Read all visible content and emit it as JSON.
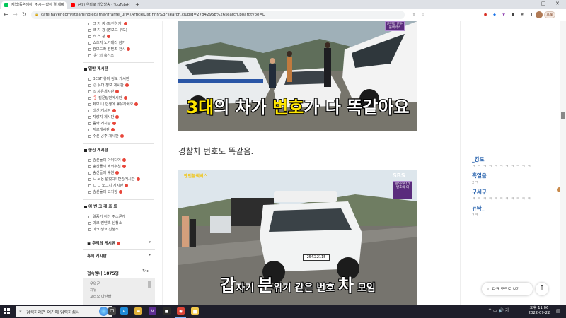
{
  "browser": {
    "tabs": [
      {
        "title": "재업(동역에이) 주시는 잡어 걸 게이",
        "active": true,
        "favicon_color": "#03c75a"
      },
      {
        "title": "(49) 우파로 개입방송 - YouTube",
        "active": false,
        "favicon_color": "#ff0000"
      }
    ],
    "new_tab": "+",
    "window_buttons": [
      "—",
      "□",
      "✕"
    ],
    "nav": {
      "back": "←",
      "forward": "→",
      "reload": "↻"
    },
    "url": "cafe.naver.com/steamindiegame?iframe_url=/ArticleList.nhn%3Fsearch.clubid=27842958%26search.boardtype=L",
    "extensions": [
      {
        "icon": "share-icon",
        "glyph": "⇪",
        "color": "#666"
      },
      {
        "icon": "star-icon",
        "glyph": "☆",
        "color": "#666"
      },
      {
        "icon": "ext-red-icon",
        "glyph": "●",
        "color": "#d93025"
      },
      {
        "icon": "ext-blue-icon",
        "glyph": "◆",
        "color": "#1a73e8"
      },
      {
        "icon": "ext-purple-icon",
        "glyph": "V",
        "color": "#7b1fa2"
      },
      {
        "icon": "ext-dark-icon",
        "glyph": "■",
        "color": "#444"
      },
      {
        "icon": "ext-puzzle-icon",
        "glyph": "✱",
        "color": "#666"
      },
      {
        "icon": "sidebar-icon",
        "glyph": "▮",
        "color": "#666"
      }
    ],
    "profile_label": "프로"
  },
  "sidebar": {
    "top_items": [
      {
        "label": "크 지 광 (트전하기)",
        "new": true
      },
      {
        "label": "크 지 광 (방보드 투보)",
        "new": false
      },
      {
        "label": "쇼 스 광",
        "new": true
      },
      {
        "label": "쇼츠지 노가데리 감기",
        "new": false
      },
      {
        "label": "컴보드라 컨텐츠 전시",
        "new": true
      },
      {
        "label": "'운' 의 혹신소",
        "new": false
      }
    ],
    "section_general": "일반 게시판",
    "general_items": [
      {
        "label": "BEST 유머 정보 게시판",
        "new": false
      },
      {
        "label": "🐱 유머,정보 게시판",
        "new": true
      },
      {
        "label": "⚠ 자유게시판",
        "new": true
      },
      {
        "label": "❓ 질문답변게시판",
        "new": true
      },
      {
        "label": "제보 내 인생에 후유하세요",
        "new": true
      },
      {
        "label": "대신 게시판",
        "new": true
      },
      {
        "label": "자랑지 게시판",
        "new": true
      },
      {
        "label": "음악 게시판",
        "new": true
      },
      {
        "label": "지르게시판",
        "new": true
      },
      {
        "label": "수신 공주 게시판",
        "new": true
      }
    ],
    "section_fan": "송신 게시판",
    "fan_items": [
      {
        "label": "송신들의 아이디어",
        "new": true
      },
      {
        "label": "송신들의 제의추천",
        "new": true
      },
      {
        "label": "송신들의 후원",
        "new": true
      },
      {
        "label": "ㄴ 노동 없었다! 반송게시판",
        "new": true
      },
      {
        "label": "ㄴ ㄴ 노그지 게시판",
        "new": true
      },
      {
        "label": "송신들의 고지장",
        "new": true
      }
    ],
    "section_cafe": "이 번 크 레 프 트",
    "cafe_items": [
      {
        "label": "알풍기 어선 주소론게",
        "new": false
      },
      {
        "label": "마크 컨텐츠 신청소",
        "new": false
      },
      {
        "label": "마크 생쿄 신청소",
        "new": false
      }
    ],
    "folder_button": "추억의 게시판",
    "folder_new": true,
    "folder_button2": "휴식 게시판",
    "members_title": "접속멤버 1875명",
    "members_ctrl": "↻ ▸",
    "members": [
      "우왁굳",
      "지유",
      "고리오 다란바",
      "..."
    ]
  },
  "article": {
    "photo1": {
      "caption_parts": [
        {
          "text": "3대",
          "highlight": true
        },
        {
          "text": "의 차가 ",
          "highlight": false
        },
        {
          "text": "번호",
          "highlight": true
        },
        {
          "text": "가 다 똑같아요",
          "highlight": false
        }
      ],
      "badge": "운전의 한수\n블랙박스"
    },
    "paragraph1": "경찰차 번호도 똑같음.",
    "photo2": {
      "caption_parts": [
        {
          "text": "갑",
          "highlight": false,
          "big": true
        },
        {
          "text": "자기 ",
          "highlight": false,
          "big": false
        },
        {
          "text": "분",
          "highlight": false,
          "big": true
        },
        {
          "text": "위기 같은 번호 ",
          "highlight": false,
          "big": false
        },
        {
          "text": "차",
          "highlight": false,
          "big": true
        },
        {
          "text": " 모임",
          "highlight": false,
          "big": false
        }
      ],
      "sbs": "SBS",
      "badge": "한의하다기\n번호의 의",
      "logo": "맨인블랙박스",
      "plate": "254고2115"
    }
  },
  "chat": [
    {
      "name": "_강도",
      "sub": "ㅋ ㅋ ㅋ ㅋ ㅋ ㅋ ㅋ ㅋ ㅋ ㅋ ㅋ"
    },
    {
      "name": "흑얼음",
      "sub": "2ㅋ"
    },
    {
      "name": "구세구",
      "sub": "ㅋ ㅋ ㅋ ㅋ ㅋ ㅋ ㅋ ㅋ ㅋ ㅋ ㅋ"
    },
    {
      "name": "뉴타_",
      "sub": "2ㅋ"
    }
  ],
  "floating": {
    "darkmode": "☾ 다크 모드로 보기",
    "scrolltop": "↑"
  },
  "taskbar": {
    "search_placeholder": "검색하려면 여기에 입력하십시",
    "search_icon": "🔍",
    "apps": [
      {
        "icon": "taskview-icon",
        "glyph": "❐",
        "color": "#444"
      },
      {
        "icon": "edge-icon",
        "glyph": "e",
        "color": "#1e8ad6"
      },
      {
        "icon": "explorer-icon",
        "glyph": "▬",
        "color": "#e0b23a"
      },
      {
        "icon": "vs-icon",
        "glyph": "V",
        "color": "#5c2d91"
      },
      {
        "icon": "app-icon",
        "glyph": "■",
        "color": "#2b2b2b"
      },
      {
        "icon": "chrome-icon",
        "glyph": "◉",
        "color": "#db4437"
      },
      {
        "icon": "folder-icon",
        "glyph": "▆",
        "color": "#f2c94c"
      }
    ],
    "tray": "^ ▭ 🔊 가",
    "time": "오후 11:06",
    "date": "2022-09-22",
    "notif": "▤"
  }
}
